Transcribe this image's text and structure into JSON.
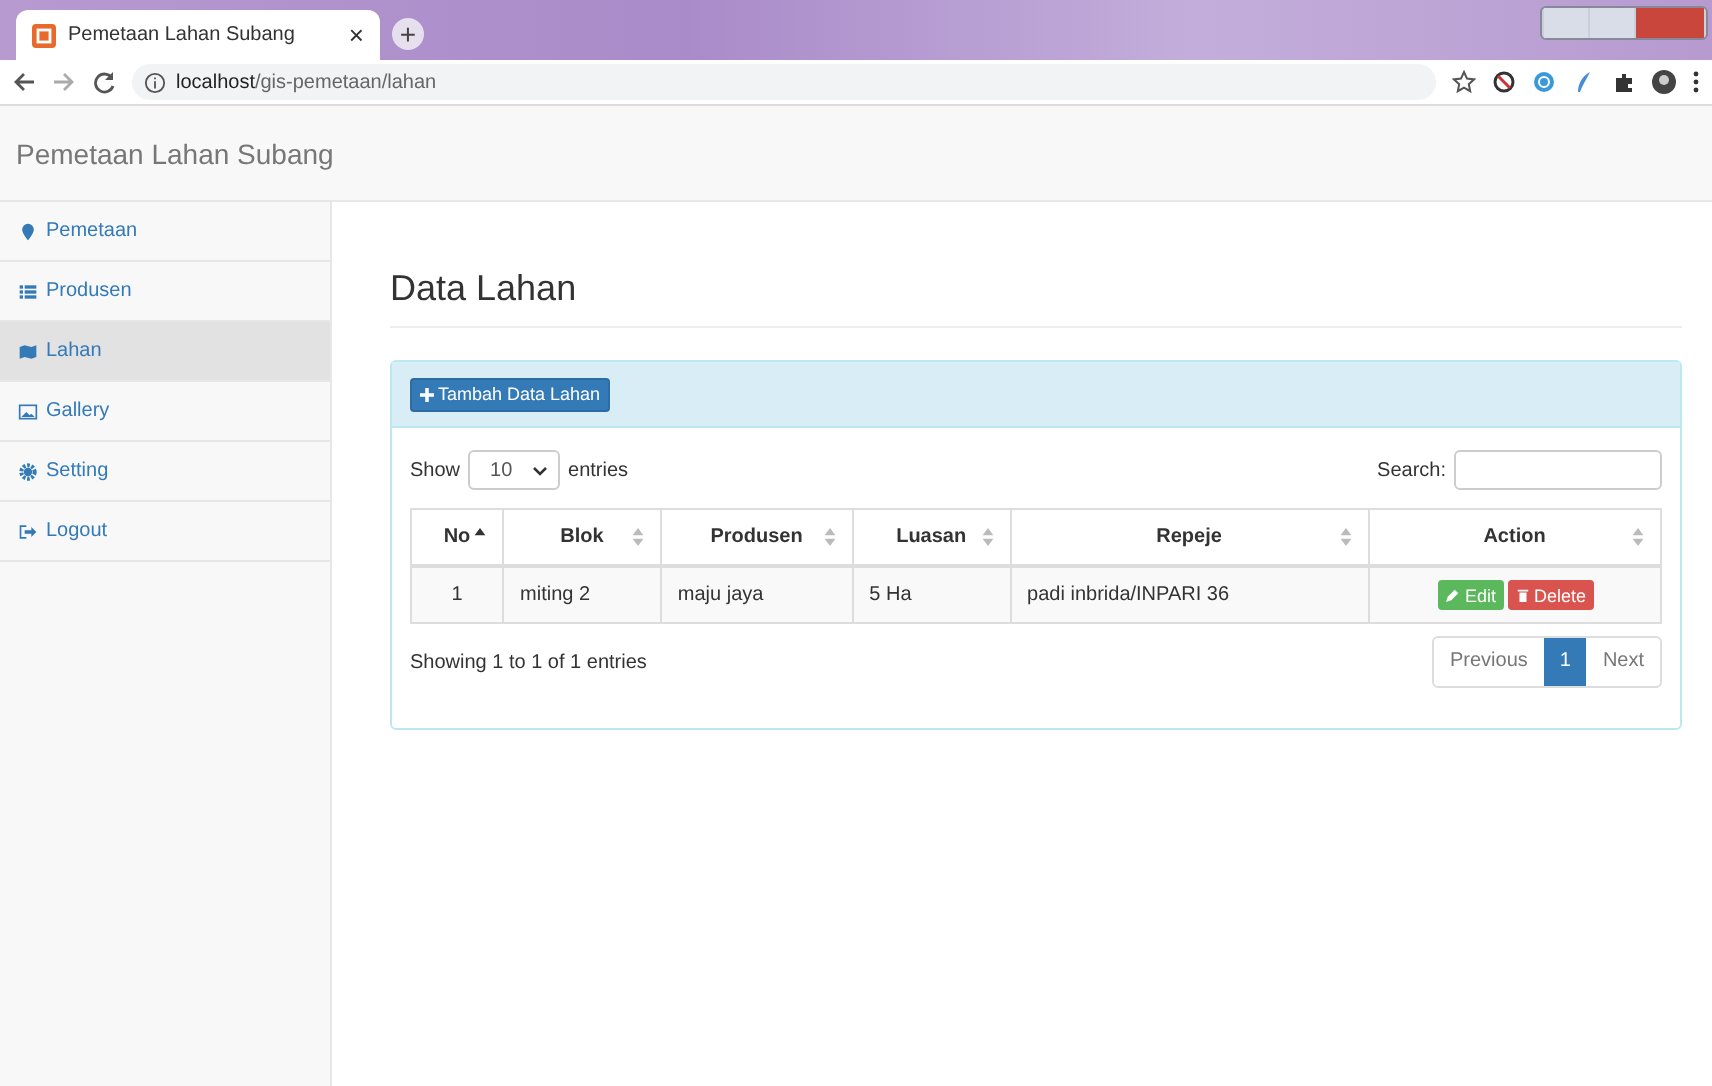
{
  "browser": {
    "tab_title": "Pemetaan Lahan Subang",
    "tab_close": "×",
    "new_tab": "+",
    "url_host": "localhost",
    "url_path": "/gis-pemetaan/lahan"
  },
  "navbar": {
    "brand": "Pemetaan Lahan Subang"
  },
  "sidebar": {
    "items": [
      {
        "label": "Pemetaan",
        "kind": "pin",
        "selected": false
      },
      {
        "label": "Produsen",
        "kind": "list",
        "selected": false
      },
      {
        "label": "Lahan",
        "kind": "map",
        "selected": true
      },
      {
        "label": "Gallery",
        "kind": "image",
        "selected": false
      },
      {
        "label": "Setting",
        "kind": "gear",
        "selected": false
      },
      {
        "label": "Logout",
        "kind": "logout",
        "selected": false
      }
    ]
  },
  "page": {
    "title": "Data Lahan",
    "add_button": "Tambah Data Lahan",
    "length": {
      "show": "Show",
      "value": "10",
      "entries": "entries"
    },
    "search": {
      "label": "Search:"
    },
    "table": {
      "columns": [
        {
          "label": "No",
          "sorted": true
        },
        {
          "label": "Blok",
          "sorted": false
        },
        {
          "label": "Produsen",
          "sorted": false
        },
        {
          "label": "Luasan",
          "sorted": false
        },
        {
          "label": "Repeje",
          "sorted": false
        },
        {
          "label": "Action",
          "sorted": false
        }
      ],
      "rows": [
        {
          "cells": [
            "1",
            "miting 2",
            "maju jaya",
            "5 Ha",
            "padi inbrida/INPARI 36"
          ],
          "actions": [
            {
              "kind": "edit",
              "label": "Edit"
            },
            {
              "kind": "delete",
              "label": "Delete"
            }
          ]
        }
      ]
    },
    "info": "Showing 1 to 1 of 1 entries",
    "pagination": [
      {
        "label": "Previous",
        "selected": false
      },
      {
        "label": "1",
        "selected": true
      },
      {
        "label": "Next",
        "selected": false
      }
    ]
  }
}
